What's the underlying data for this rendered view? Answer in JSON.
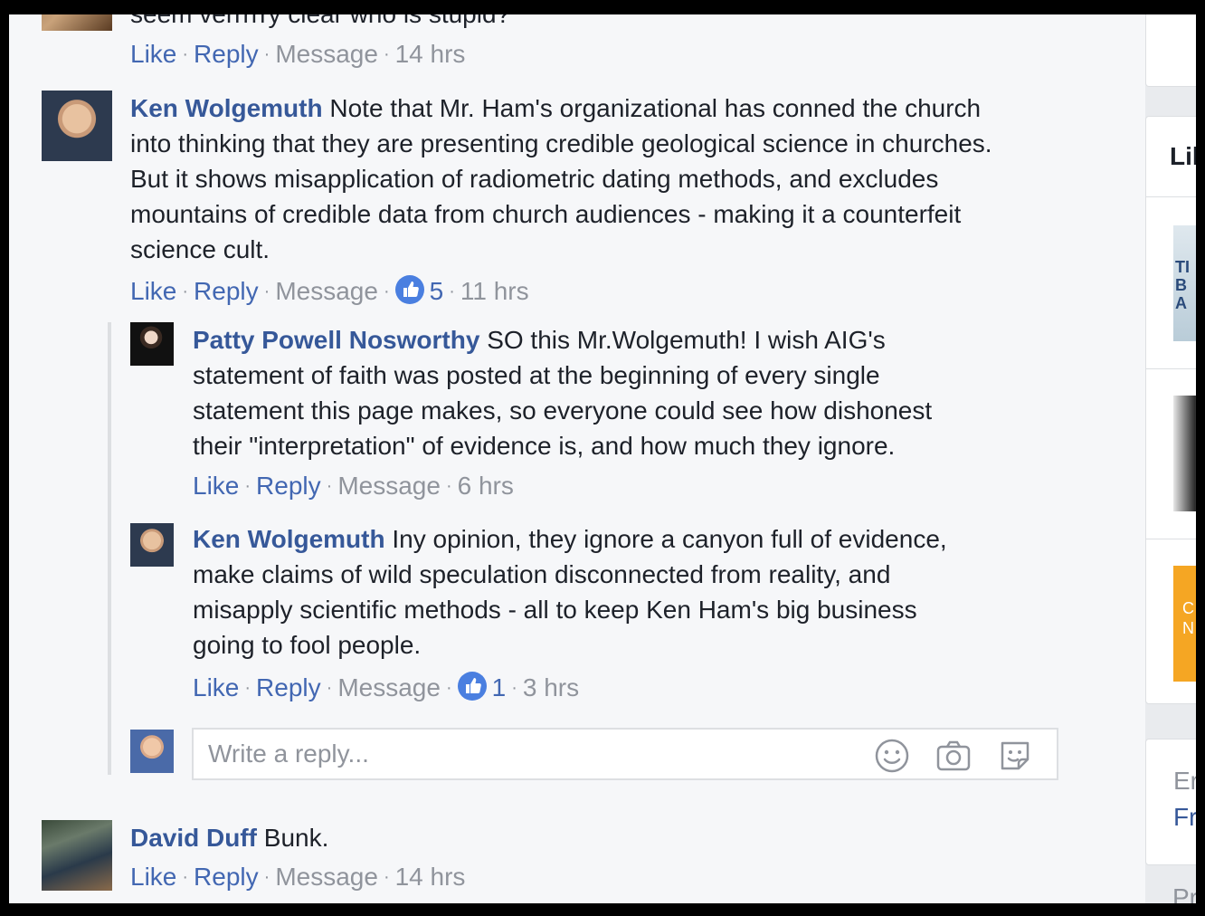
{
  "top_comment": {
    "partial_text": "seem verrrrry clear who is stupid?",
    "actions": {
      "like": "Like",
      "reply": "Reply",
      "message": "Message",
      "time": "14 hrs"
    }
  },
  "comments": [
    {
      "author": "Ken Wolgemuth",
      "text_lines": [
        "Note that Mr. Ham's organizational has conned the church",
        "into thinking that they are presenting credible geological science in churches.",
        "But it shows misapplication of radiometric dating methods, and excludes",
        "mountains of credible data from church audiences - making it a counterfeit",
        "science cult."
      ],
      "actions": {
        "like": "Like",
        "reply": "Reply",
        "message": "Message",
        "likes": "5",
        "time": "11 hrs"
      },
      "replies": [
        {
          "author": "Patty Powell Nosworthy",
          "text_lines": [
            "SO this Mr.Wolgemuth! I wish AIG's",
            "statement of faith was posted at the beginning of every single",
            "statement this page makes, so everyone could see how dishonest",
            "their \"interpretation\" of evidence is, and how much they ignore."
          ],
          "actions": {
            "like": "Like",
            "reply": "Reply",
            "message": "Message",
            "time": "6 hrs"
          }
        },
        {
          "author": "Ken Wolgemuth",
          "text_lines": [
            "Iny opinion, they ignore a canyon full of evidence,",
            "make claims of wild speculation disconnected from reality, and",
            "misapply scientific methods - all to keep Ken Ham's big business",
            "going to fool people."
          ],
          "actions": {
            "like": "Like",
            "reply": "Reply",
            "message": "Message",
            "likes": "1",
            "time": "3 hrs"
          }
        }
      ],
      "reply_box": {
        "placeholder": "Write a reply..."
      }
    },
    {
      "author": "David Duff",
      "text_lines": [
        "Bunk."
      ],
      "actions": {
        "like": "Like",
        "reply": "Reply",
        "message": "Message",
        "time": "14 hrs"
      }
    }
  ],
  "sidebar": {
    "heading_partial": "Lik",
    "thumb_text": "TI BA",
    "orange_text": "C N",
    "text_1": "Er",
    "text_2": "Fr",
    "text_3": "Pr"
  },
  "colors": {
    "link": "#365899",
    "action": "#4267b2",
    "muted": "#90949c",
    "background": "#f6f7f9",
    "like_badge": "#4a7fe0"
  }
}
